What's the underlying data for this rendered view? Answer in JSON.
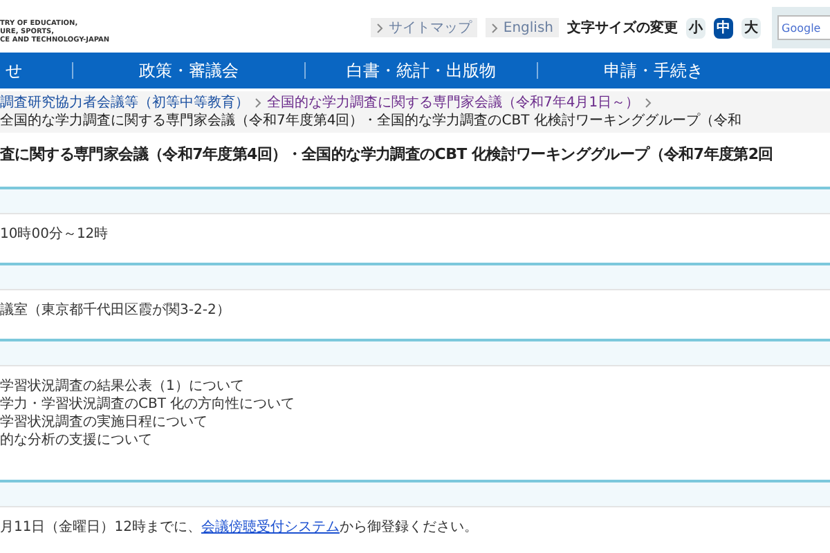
{
  "header": {
    "logo_lines": [
      "TRY OF EDUCATION,",
      "URE, SPORTS,",
      "CE AND TECHNOLOGY-JAPAN"
    ],
    "links": [
      {
        "label": "サイトマップ"
      },
      {
        "label": "English"
      }
    ],
    "font_size": {
      "label": "文字サイズの変更",
      "options": [
        {
          "label": "小",
          "selected": false
        },
        {
          "label": "中",
          "selected": true
        },
        {
          "label": "大",
          "selected": false
        }
      ]
    },
    "search": {
      "placeholder": "Google"
    }
  },
  "nav": [
    "せ",
    "政策・審議会",
    "白書・統計・出版物",
    "申請・手続き"
  ],
  "breadcrumb": [
    {
      "label": "調査研究協力者会議等（初等中等教育）",
      "kind": "link"
    },
    {
      "label": "全国的な学力調査に関する専門家会議（令和7年4月1日～）",
      "kind": "visited"
    },
    {
      "label": "全国的な学力調査に関する専門家会議（令和7年度第4回）・全国的な学力調査のCBT 化検討ワーキンググループ（令和",
      "kind": "current"
    }
  ],
  "title": "査に関する専門家会議（令和7年度第4回）・全国的な学力調査のCBT 化検討ワーキンググループ（令和7年度第2回",
  "sections": [
    {
      "kind": "lines",
      "lines": [
        "10時00分～12時"
      ]
    },
    {
      "kind": "lines",
      "lines": [
        "議室（東京都千代田区霞が関3-2-2）"
      ]
    },
    {
      "kind": "lines",
      "lines": [
        "学習状況調査の結果公表（1）について",
        "学力・学習状況調査のCBT 化の方向性について",
        "学習状況調査の実施日程について",
        "的な分析の支援について"
      ]
    },
    {
      "kind": "link_sentence",
      "before": "月11日（金曜日）12時までに、",
      "link": "会議傍聴受付システム",
      "after": "から御登録ください。"
    }
  ]
}
